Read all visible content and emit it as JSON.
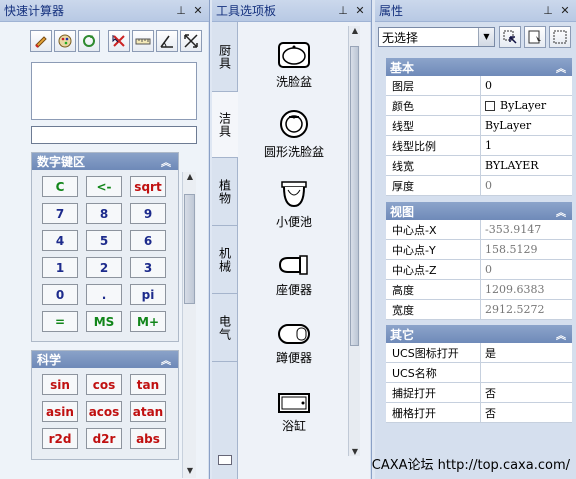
{
  "calculator": {
    "title": "快速计算器",
    "toolbar_icons": [
      "eraser-icon",
      "palette-icon",
      "refresh-icon",
      "select-cross-icon",
      "ruler-icon",
      "angle-icon",
      "expand-icon"
    ],
    "numeric_group": {
      "title": "数字键区",
      "keys": [
        {
          "label": "C",
          "color": "green"
        },
        {
          "label": "<-",
          "color": "green"
        },
        {
          "label": "sqrt",
          "color": "red"
        },
        {
          "label": "7",
          "color": "blue"
        },
        {
          "label": "8",
          "color": "blue"
        },
        {
          "label": "9",
          "color": "blue"
        },
        {
          "label": "4",
          "color": "blue"
        },
        {
          "label": "5",
          "color": "blue"
        },
        {
          "label": "6",
          "color": "blue"
        },
        {
          "label": "1",
          "color": "blue"
        },
        {
          "label": "2",
          "color": "blue"
        },
        {
          "label": "3",
          "color": "blue"
        },
        {
          "label": "0",
          "color": "blue"
        },
        {
          "label": ".",
          "color": "blue"
        },
        {
          "label": "pi",
          "color": "blue"
        },
        {
          "label": "=",
          "color": "green"
        },
        {
          "label": "MS",
          "color": "green"
        },
        {
          "label": "M+",
          "color": "green"
        }
      ]
    },
    "science_group": {
      "title": "科学",
      "keys": [
        {
          "label": "sin",
          "color": "red"
        },
        {
          "label": "cos",
          "color": "red"
        },
        {
          "label": "tan",
          "color": "red"
        },
        {
          "label": "asin",
          "color": "red"
        },
        {
          "label": "acos",
          "color": "red"
        },
        {
          "label": "atan",
          "color": "red"
        },
        {
          "label": "r2d",
          "color": "red"
        },
        {
          "label": "d2r",
          "color": "red"
        },
        {
          "label": "abs",
          "color": "red"
        }
      ]
    }
  },
  "toolbox": {
    "title": "工具选项板",
    "tabs": [
      "厨具",
      "洁具",
      "植物",
      "机械",
      "电气"
    ],
    "active_tab": "洁具",
    "items": [
      "洗脸盆",
      "圆形洗脸盆",
      "小便池",
      "座便器",
      "蹲便器",
      "浴缸"
    ]
  },
  "properties": {
    "title": "属性",
    "selection": "无选择",
    "sections": [
      {
        "title": "基本",
        "rows": [
          {
            "name": "图层",
            "value": "0"
          },
          {
            "name": "颜色",
            "value": "ByLayer",
            "swatch": true
          },
          {
            "name": "线型",
            "value": "ByLayer"
          },
          {
            "name": "线型比例",
            "value": "1"
          },
          {
            "name": "线宽",
            "value": "BYLAYER"
          },
          {
            "name": "厚度",
            "value": "0",
            "gray": true
          }
        ]
      },
      {
        "title": "视图",
        "rows": [
          {
            "name": "中心点-X",
            "value": "-353.9147",
            "gray": true
          },
          {
            "name": "中心点-Y",
            "value": "158.5129",
            "gray": true
          },
          {
            "name": "中心点-Z",
            "value": "0",
            "gray": true
          },
          {
            "name": "高度",
            "value": "1209.6383",
            "gray": true
          },
          {
            "name": "宽度",
            "value": "2912.5272",
            "gray": true
          }
        ]
      },
      {
        "title": "其它",
        "rows": [
          {
            "name": "UCS图标打开",
            "value": "是"
          },
          {
            "name": "UCS名称",
            "value": ""
          },
          {
            "name": "捕捉打开",
            "value": "否"
          },
          {
            "name": "栅格打开",
            "value": "否"
          }
        ]
      }
    ]
  },
  "watermark": "CAXA论坛 http://top.caxa.com/",
  "colors": {
    "green": "#12861a",
    "blue": "#1d2b8c",
    "red": "#c01010",
    "header": "#7a93c0"
  }
}
